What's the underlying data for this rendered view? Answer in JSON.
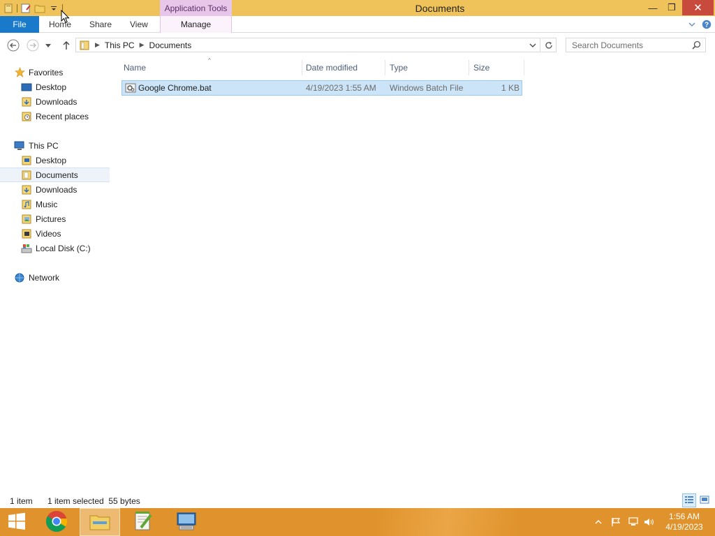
{
  "window": {
    "title": "Documents",
    "contextual_tab": "Application Tools",
    "minimize": "—",
    "restore": "❐",
    "close": "✕"
  },
  "ribbon": {
    "tabs": [
      "File",
      "Home",
      "Share",
      "View",
      "Manage"
    ],
    "collapse": "⌵",
    "help": "?"
  },
  "address": {
    "crumbs": [
      "This PC",
      "Documents"
    ],
    "search_placeholder": "Search Documents"
  },
  "nav_pane": {
    "favorites": {
      "label": "Favorites",
      "items": [
        "Desktop",
        "Downloads",
        "Recent places"
      ]
    },
    "this_pc": {
      "label": "This PC",
      "items": [
        "Desktop",
        "Documents",
        "Downloads",
        "Music",
        "Pictures",
        "Videos",
        "Local Disk (C:)"
      ],
      "selected": "Documents"
    },
    "network": {
      "label": "Network"
    }
  },
  "file_list": {
    "columns": [
      "Name",
      "Date modified",
      "Type",
      "Size"
    ],
    "rows": [
      {
        "name": "Google Chrome.bat",
        "date_modified": "4/19/2023 1:55 AM",
        "type": "Windows Batch File",
        "size": "1 KB"
      }
    ]
  },
  "status_bar": {
    "count": "1 item",
    "selection": "1 item selected  55 bytes"
  },
  "taskbar": {
    "apps": [
      "start-button",
      "chrome",
      "file-explorer",
      "notepad-plus-plus",
      "remote-desktop"
    ],
    "time": "1:56 AM",
    "date": "4/19/2023"
  },
  "colors": {
    "title_bar": "#f0c35a",
    "file_tab": "#1979ca",
    "selection": "#cce4f7",
    "taskbar": "#e0932c",
    "close_button": "#c74a3c"
  }
}
